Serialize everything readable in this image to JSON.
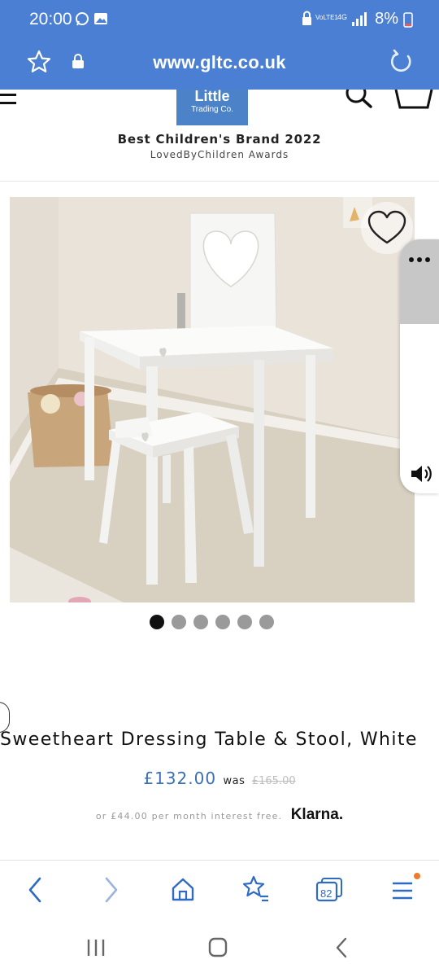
{
  "status_bar": {
    "time": "20:00",
    "battery": "8%",
    "icons": [
      "whatsapp-icon",
      "gallery-icon",
      "lock-icon",
      "volte-icon",
      "4g-icon",
      "signal-icon",
      "battery-icon"
    ]
  },
  "browser": {
    "url": "www.gltc.co.uk",
    "icons": [
      "star-icon",
      "lock-icon",
      "reload-icon"
    ],
    "tab_count": "82"
  },
  "site": {
    "logo_line1": "Little",
    "logo_line2": "Trading Co.",
    "award_title": "Best Children's Brand 2022",
    "award_sub": "LovedByChildren Awards"
  },
  "product": {
    "title": "Sweetheart Dressing Table & Stool, White",
    "price": "£132.00",
    "was_label": "was",
    "old_price": "£165.00",
    "klarna_text": "or £44.00 per month interest free.",
    "klarna_brand": "Klarna.",
    "image_count": 6,
    "active_image": 1
  },
  "colors": {
    "browser_bar": "#4a7fd4",
    "brand_blue": "#4b82c8",
    "price_blue": "#3b6fb2"
  }
}
